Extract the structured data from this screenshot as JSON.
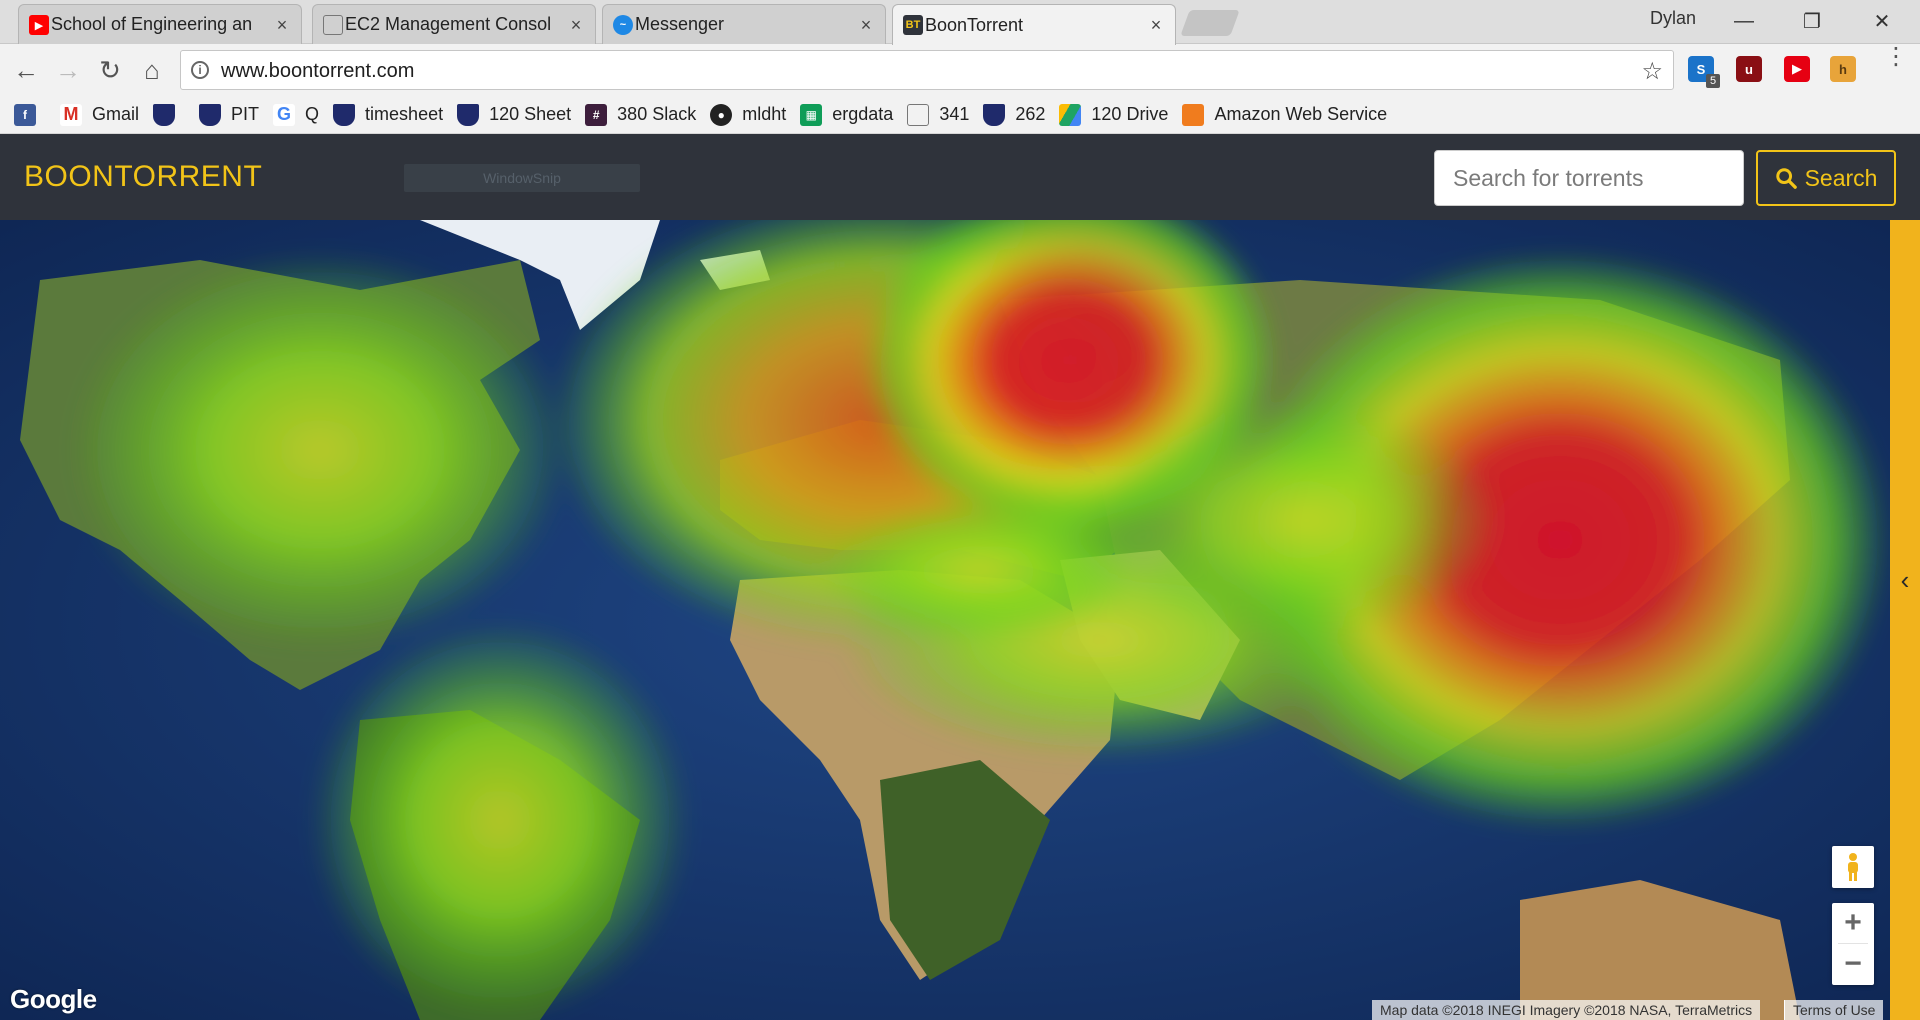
{
  "browser": {
    "tabs": [
      {
        "title": "School of Engineering an",
        "favicon": "youtube-icon",
        "color": "#ff0000"
      },
      {
        "title": "EC2 Management Consol",
        "favicon": "page-icon",
        "color": "#888888"
      },
      {
        "title": "Messenger",
        "favicon": "messenger-icon",
        "color": "#1e88e5"
      },
      {
        "title": "BoonTorrent",
        "favicon": "BT",
        "color": "#2f333b"
      }
    ],
    "profile_name": "Dylan",
    "url": "www.boontorrent.com",
    "extension_badge": "5"
  },
  "bookmarks": [
    {
      "label": "",
      "icon": "facebook-icon",
      "color": "#3b5998"
    },
    {
      "label": "Gmail",
      "icon": "gmail-icon",
      "color": "#d93025"
    },
    {
      "label": "",
      "icon": "penn-shield-icon",
      "color": "#1f2a6b"
    },
    {
      "label": "PIT",
      "icon": "penn-shield-icon",
      "color": "#1f2a6b"
    },
    {
      "label": "Q",
      "icon": "google-icon",
      "color": "#4285f4"
    },
    {
      "label": "timesheet",
      "icon": "penn-shield-icon",
      "color": "#1f2a6b"
    },
    {
      "label": "120 Sheet",
      "icon": "penn-shield-icon",
      "color": "#1f2a6b"
    },
    {
      "label": "380 Slack",
      "icon": "slack-icon",
      "color": "#3d1e3c"
    },
    {
      "label": "mldht",
      "icon": "github-icon",
      "color": "#222222"
    },
    {
      "label": "ergdata",
      "icon": "sheets-icon",
      "color": "#0f9d58"
    },
    {
      "label": "341",
      "icon": "page-icon",
      "color": "#888888"
    },
    {
      "label": "262",
      "icon": "penn-shield-icon",
      "color": "#1f2a6b"
    },
    {
      "label": "120 Drive",
      "icon": "drive-icon",
      "color": "#1fa463"
    },
    {
      "label": "Amazon Web Service",
      "icon": "aws-icon",
      "color": "#f07c1e"
    }
  ],
  "site": {
    "brand": "BOONTORRENT",
    "ghost_overlay": "WindowSnip",
    "search_placeholder": "Search for torrents",
    "search_button": "Search",
    "accent": "#f2c418",
    "navbar_bg": "#2f333b"
  },
  "map": {
    "type": "satellite heatmap of torrent activity",
    "hotspots": [
      "Eastern Europe",
      "China / Southeast Asia"
    ],
    "google_logo": "Google",
    "attribution": "Map data ©2018 INEGI Imagery ©2018 NASA, TerraMetrics",
    "terms": "Terms of Use",
    "zoom_in": "+",
    "zoom_out": "−",
    "panel_toggle": "‹"
  }
}
